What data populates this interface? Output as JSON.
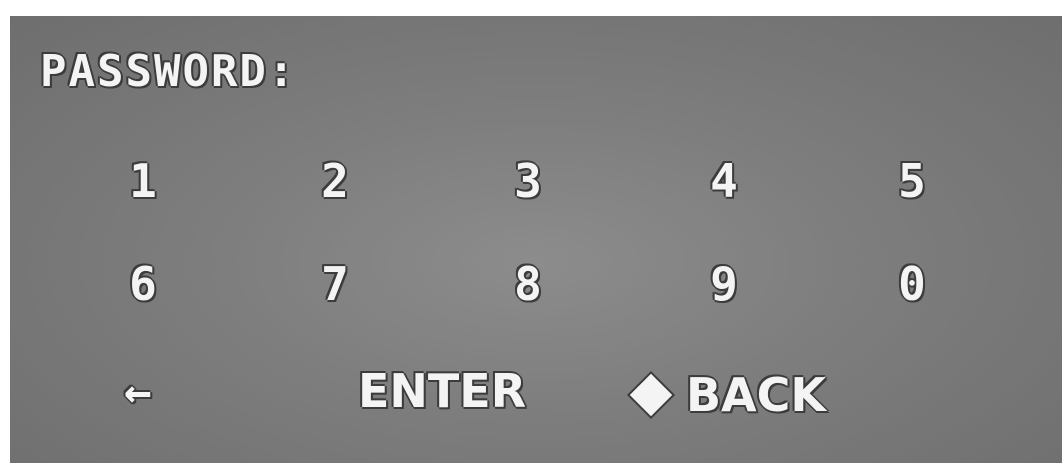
{
  "header": {
    "title": "PASSWORD:"
  },
  "keypad": {
    "row1": [
      "1",
      "2",
      "3",
      "4",
      "5"
    ],
    "row2": [
      "6",
      "7",
      "8",
      "9",
      "0"
    ]
  },
  "actions": {
    "backspace_icon": "left-arrow-icon",
    "enter_label": "ENTER",
    "back_icon": "diamond-icon",
    "back_label": "BACK"
  },
  "colors": {
    "background": "#7d7d7d",
    "text": "#f4f4f4",
    "outline": "#3c3c3c"
  }
}
